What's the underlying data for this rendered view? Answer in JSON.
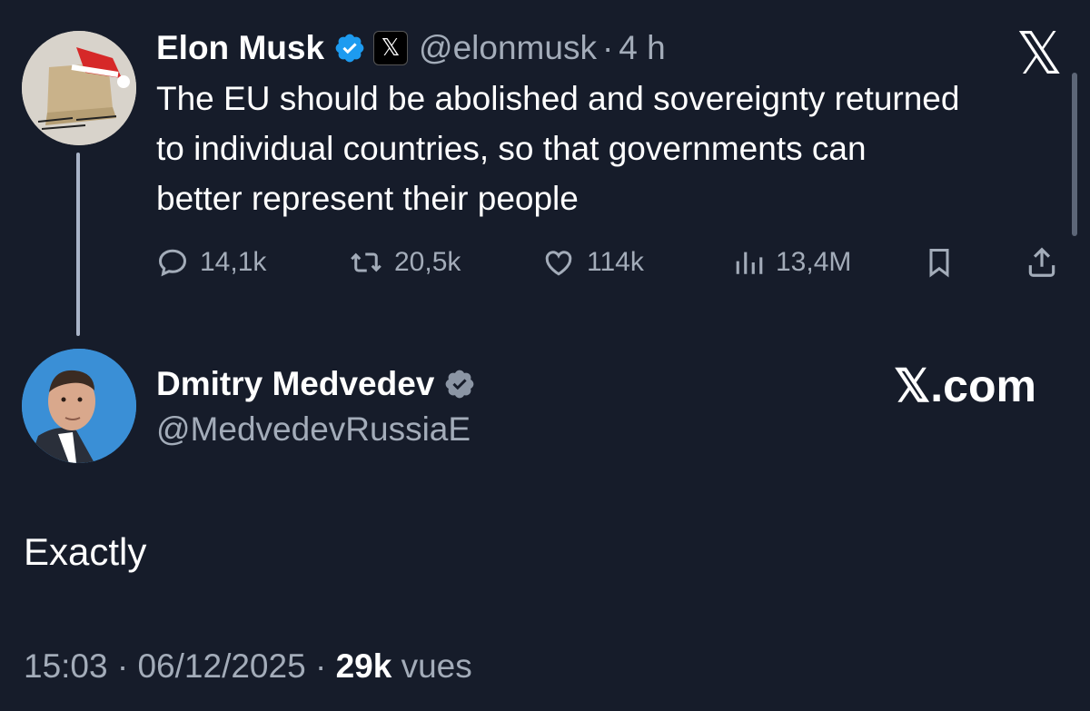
{
  "original_tweet": {
    "author_name": "Elon Musk",
    "handle": "@elonmusk",
    "time_sep": "·",
    "time": "4 h",
    "x_badge_icon": "x-logo-icon",
    "text_lines": [
      "The EU should be abolished and sovereignty returned",
      "to individual countries, so that governments can",
      "better represent their people"
    ],
    "stats": {
      "replies": "14,1k",
      "reposts": "20,5k",
      "likes": "114k",
      "views": "13,4M"
    }
  },
  "reply_tweet": {
    "author_name": "Dmitry Medvedev",
    "handle": "@MedvedevRussiaE",
    "text": "Exactly",
    "footer": {
      "time": "15:03",
      "sep1": "·",
      "date": "06/12/2025",
      "sep2": "·",
      "views_count": "29k",
      "views_label": "vues"
    }
  },
  "branding": {
    "top_logo": "𝕏",
    "site": "𝕏.com"
  },
  "colors": {
    "background": "#161c2a",
    "verified_blue": "#1d9bf0",
    "muted_text": "#a3acb9"
  }
}
